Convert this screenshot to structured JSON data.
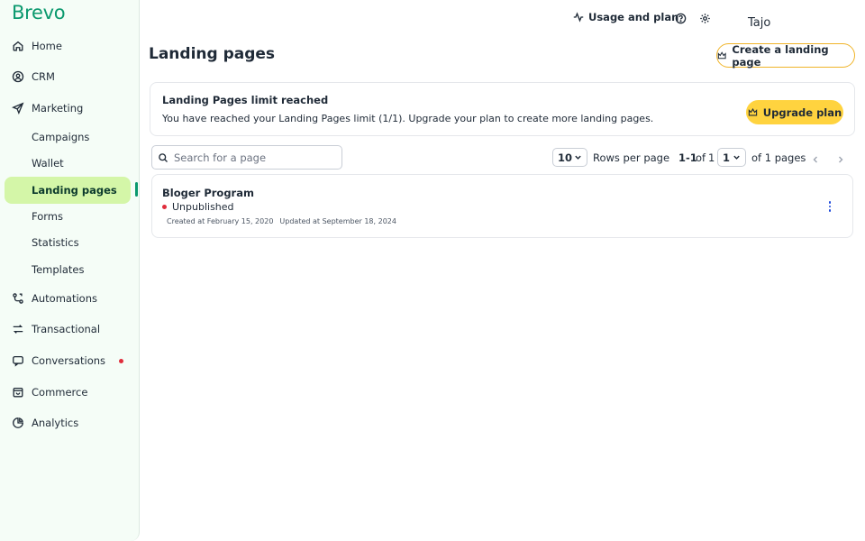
{
  "brand": {
    "logo_text": "Brevo",
    "accent": "#0b996e",
    "active_bg": "#d4f6a8",
    "cta": "#ffd33f"
  },
  "sidebar": {
    "items": [
      {
        "label": "Home",
        "icon": "home-icon"
      },
      {
        "label": "CRM",
        "icon": "contacts-icon"
      },
      {
        "label": "Marketing",
        "icon": "send-icon"
      },
      {
        "label": "Campaigns"
      },
      {
        "label": "Wallet"
      },
      {
        "label": "Landing pages",
        "active": true
      },
      {
        "label": "Forms"
      },
      {
        "label": "Statistics"
      },
      {
        "label": "Templates"
      },
      {
        "label": "Automations",
        "icon": "automation-icon"
      },
      {
        "label": "Transactional",
        "icon": "transactional-icon"
      },
      {
        "label": "Conversations",
        "icon": "chat-icon",
        "badge": "red-dot"
      },
      {
        "label": "Commerce",
        "icon": "bag-icon"
      },
      {
        "label": "Analytics",
        "icon": "pie-chart-icon"
      }
    ]
  },
  "topbar": {
    "usage_label": "Usage and plan",
    "help_icon": "help-circle-icon",
    "settings_icon": "gear-icon",
    "user_name": "Tajo"
  },
  "page": {
    "title": "Landing pages",
    "create_button": "Create a landing page"
  },
  "alert": {
    "title": "Landing Pages limit reached",
    "text": "You have reached your Landing Pages limit (1/1). Upgrade your plan to create more landing pages.",
    "button": "Upgrade plan"
  },
  "toolbar": {
    "search_placeholder": "Search for a page",
    "rows_value": "10",
    "rows_label": "Rows per page",
    "range": "1-1",
    "of_label": "of",
    "total": "1",
    "page_value": "1",
    "pages_label": "of 1 pages"
  },
  "pages": [
    {
      "name": "Bloger Program",
      "status": "Unpublished",
      "created": "Created at February 15, 2020",
      "updated": "Updated at September 18, 2024"
    }
  ]
}
